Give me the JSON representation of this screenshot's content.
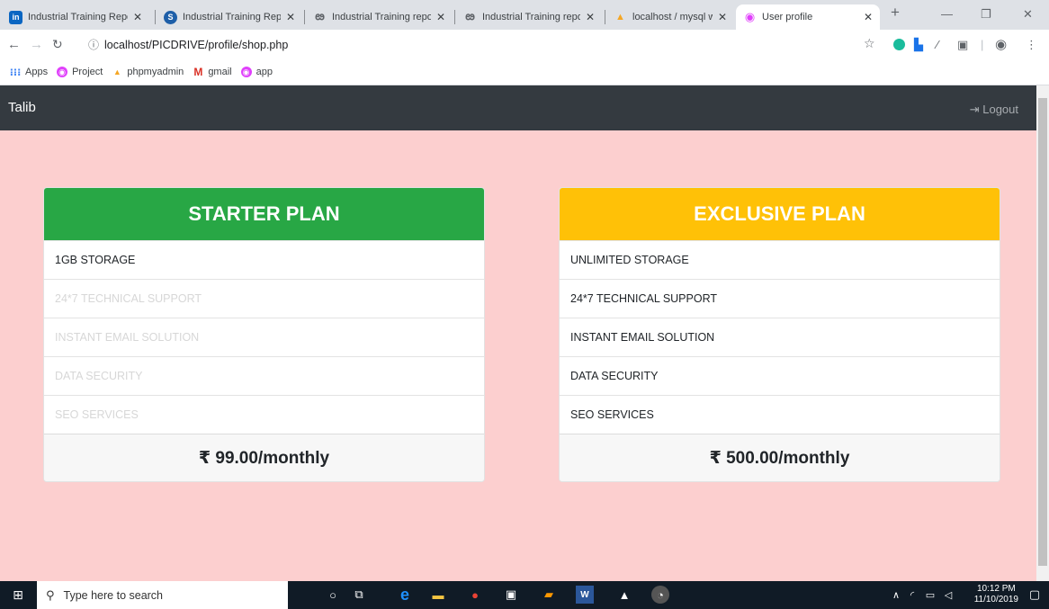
{
  "browser": {
    "tabs": [
      {
        "title": "Industrial Training Repo",
        "favicon_color": "#0a66c2",
        "favicon_glyph": "in"
      },
      {
        "title": "Industrial Training Repo",
        "favicon_color": "#1e5fa8",
        "favicon_glyph": "S"
      },
      {
        "title": "Industrial Training repo",
        "favicon_color": "#ffffff",
        "favicon_glyph": "ఴ"
      },
      {
        "title": "Industrial Training repo",
        "favicon_color": "#ffffff",
        "favicon_glyph": "ఴ"
      },
      {
        "title": "localhost / mysql wamp",
        "favicon_color": "#f5a623",
        "favicon_glyph": "▲"
      },
      {
        "title": "User profile",
        "favicon_color": "#e040fb",
        "favicon_glyph": "◉"
      }
    ],
    "url": "localhost/PICDRIVE/profile/shop.php",
    "bookmarks": [
      {
        "label": "Apps",
        "icon": "apps-grid-icon",
        "color": "#4285f4"
      },
      {
        "label": "Project",
        "icon": "project-icon",
        "color": "#e040fb"
      },
      {
        "label": "phpmyadmin",
        "icon": "phpmyadmin-icon",
        "color": "#f5a623"
      },
      {
        "label": "gmail",
        "icon": "gmail-icon",
        "color": "#d93025"
      },
      {
        "label": "app",
        "icon": "app-icon",
        "color": "#e040fb"
      }
    ]
  },
  "navbar": {
    "brand": "Talib",
    "logout_label": "Logout",
    "logout_icon": "sign-out-icon"
  },
  "plans": [
    {
      "name": "STARTER PLAN",
      "header_color": "#28a745",
      "features": [
        {
          "label": "1GB STORAGE",
          "included": true
        },
        {
          "label": "24*7 TECHNICAL SUPPORT",
          "included": false
        },
        {
          "label": "INSTANT EMAIL SOLUTION",
          "included": false
        },
        {
          "label": "DATA SECURITY",
          "included": false
        },
        {
          "label": "SEO SERVICES",
          "included": false
        }
      ],
      "price": "₹ 99.00/monthly"
    },
    {
      "name": "EXCLUSIVE PLAN",
      "header_color": "#ffc107",
      "features": [
        {
          "label": "UNLIMITED STORAGE",
          "included": true
        },
        {
          "label": "24*7 TECHNICAL SUPPORT",
          "included": true
        },
        {
          "label": "INSTANT EMAIL SOLUTION",
          "included": true
        },
        {
          "label": "DATA SECURITY",
          "included": true
        },
        {
          "label": "SEO SERVICES",
          "included": true
        }
      ],
      "price": "₹ 500.00/monthly"
    }
  ],
  "taskbar": {
    "search_placeholder": "Type here to search",
    "time": "10:12 PM",
    "date": "11/10/2019"
  },
  "colors": {
    "page_bg": "#fccfcf",
    "navbar_bg": "#343a40"
  }
}
